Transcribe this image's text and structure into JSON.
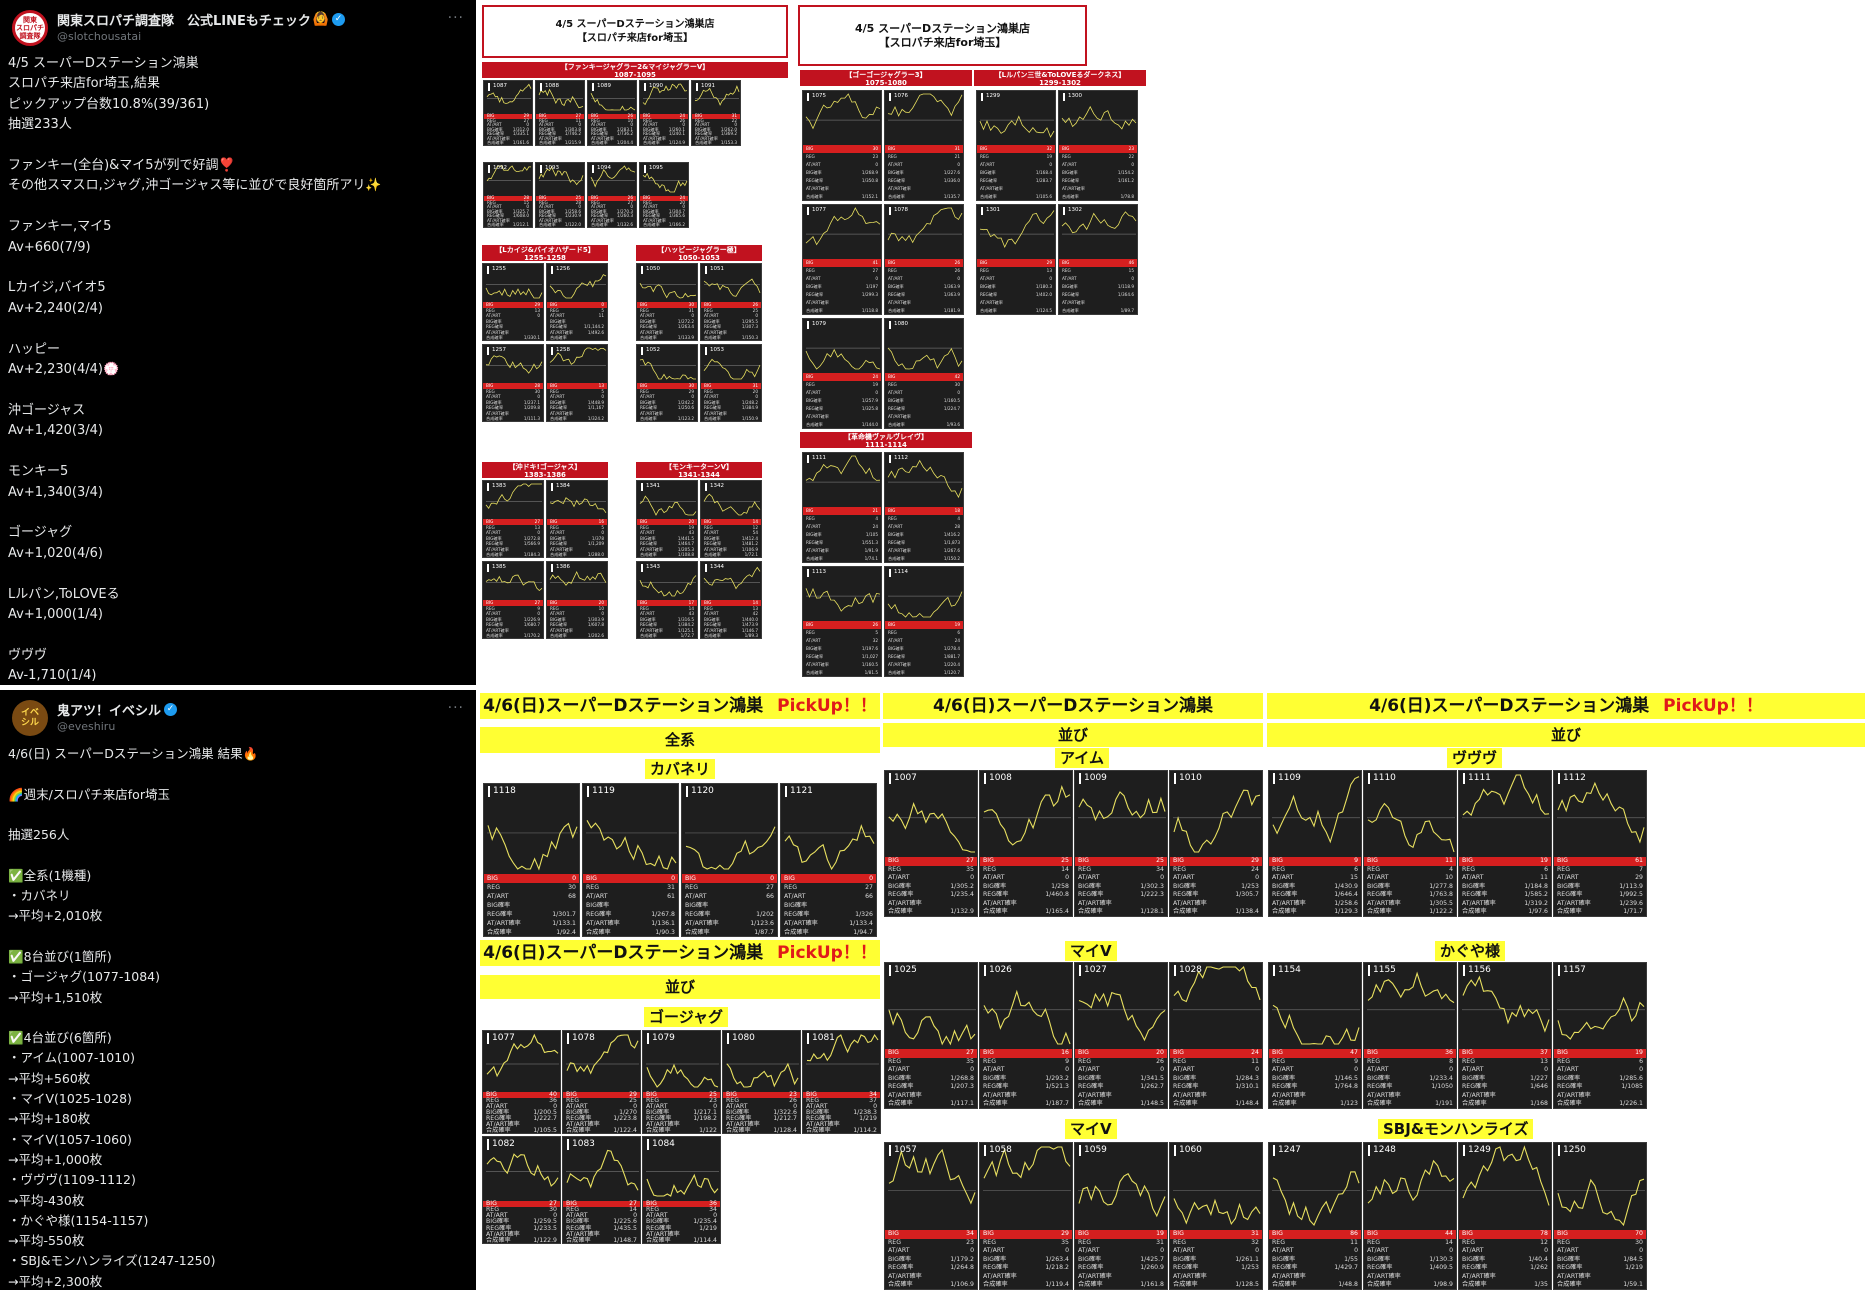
{
  "post1": {
    "display_name": "関東スロパチ調査隊　公式LINEもチェック",
    "emoji_badge": "🙆",
    "handle": "@slotchousatai",
    "avatar_text": "関東\nスロパチ\n調査隊",
    "more": "···",
    "body": "4/5 スーパーDステーション鴻巣\nスロパチ来店for埼玉,結果\nピックアップ台数10.8%(39/361)\n抽選233人\n\nファンキー(全台)&マイ5が列で好調❣️\nその他スマスロ,ジャグ,沖ゴージャス等に並びで良好箇所アリ✨\n\nファンキー,マイ5\nAv+660(7/9)\n\nLカイジ,バイオ5\nAv+2,240(2/4)\n\nハッピー\nAv+2,230(4/4)💮\n\n沖ゴージャス\nAv+1,420(3/4)\n\nモンキー5\nAv+1,340(3/4)\n\nゴージャグ\nAv+1,020(4/6)\n\nLルパン,ToLOVEる\nAv+1,000(1/4)\n\nヴヴヴ\nAv-1,710(1/4)"
  },
  "post2": {
    "display_name": "鬼アツ！イベシル",
    "handle": "@eveshiru",
    "avatar_text": "イベ\nシル",
    "more": "···",
    "body": "4/6(日) スーパーDステーション鴻巣 結果🔥\n\n🌈週末/スロパチ来店for埼玉\n\n抽選256人\n\n✅全系(1機種)\n・カバネリ\n→平均+2,010枚\n\n✅8台並び(1箇所)\n・ゴージャグ(1077-1084)\n→平均+1,510枚\n\n✅4台並び(6箇所)\n・アイム(1007-1010)\n→平均+560枚\n・マイV(1025-1028)\n→平均+180枚\n・マイV(1057-1060)\n→平均+1,000枚\n・ヴヴヴ(1109-1112)\n→平均-430枚\n・かぐや様(1154-1157)\n→平均-550枚\n・SBJ&モンハンライズ(1247-1250)\n→平均+2,300枚"
  },
  "img45": {
    "title_a": "4/5 スーパーDステーション鴻巣店",
    "title_b": "【スロパチ来店for埼玉】",
    "groups": [
      {
        "label": "【ファンキージャグラー2&マイジャグラーV】",
        "range": "1087-1095",
        "machines": [
          "1087",
          "1088",
          "1089",
          "1090",
          "1091",
          "1092",
          "1093",
          "1094",
          "1095"
        ]
      },
      {
        "label": "【Lカイジ&バイオハザード5】",
        "range": "1255-1258",
        "machines": [
          "1255",
          "1256",
          "1257",
          "1258"
        ]
      },
      {
        "label": "【ハッピージャグラー極】",
        "range": "1050-1053",
        "machines": [
          "1050",
          "1051",
          "1052",
          "1053"
        ]
      },
      {
        "label": "【沖ドキ!ゴージャス】",
        "range": "1383-1386",
        "machines": [
          "1383",
          "1384",
          "1385",
          "1386"
        ]
      },
      {
        "label": "【モンキーターンV】",
        "range": "1341-1344",
        "machines": [
          "1341",
          "1342",
          "1343",
          "1344"
        ]
      },
      {
        "label": "【ゴーゴージャグラー3】",
        "range": "1075-1080",
        "machines": [
          "1075",
          "1076",
          "1077",
          "1078",
          "1079",
          "1080"
        ]
      },
      {
        "label": "【Lルパン三世&ToLOVEるダークネス】",
        "range": "1299-1302",
        "machines": [
          "1299",
          "1300",
          "1301",
          "1302"
        ]
      },
      {
        "label": "【革命機ヴァルヴレイヴ】",
        "range": "1111-1114",
        "machines": [
          "1111",
          "1112",
          "1113",
          "1114"
        ]
      }
    ],
    "stat_labels": [
      "BIG",
      "REG",
      "AT/ART",
      "BIG確率",
      "REG確率",
      "AT/ART確率",
      "合成確率"
    ],
    "mini_values": [
      [
        "1087",
        "29",
        "27",
        "0",
        "1/312.0",
        "1/335.1",
        "",
        "1/161.6"
      ],
      [
        "1088",
        "27",
        "11",
        "0",
        "1/303.8",
        "1/746.2",
        "",
        "1/215.9"
      ],
      [
        "1089",
        "26",
        "10",
        "0",
        "1/283.1",
        "1/736.2",
        "",
        "1/204.4"
      ],
      [
        "1090",
        "24",
        "26",
        "0",
        "1/260.1",
        "1/240.1",
        "",
        "1/124.9"
      ],
      [
        "1091",
        "31",
        "22",
        "0",
        "1/262.0",
        "1/369.2",
        "",
        "1/153.3"
      ],
      [
        "1092",
        "28",
        "15",
        "0",
        "1/325.7",
        "1/608.0",
        "",
        "1/212.1"
      ],
      [
        "1093",
        "25",
        "28",
        "0",
        "1/258.6",
        "1/230.9",
        "",
        "1/122.0"
      ],
      [
        "1094",
        "26",
        "27",
        "0",
        "1/270.3",
        "1/260.3",
        "",
        "1/132.6"
      ],
      [
        "1095",
        "24",
        "20",
        "0",
        "1/304.7",
        "1/365.6",
        "",
        "1/166.2"
      ],
      [
        "1255",
        "29",
        "13",
        "0",
        "",
        "",
        "",
        "1/330.1"
      ],
      [
        "1256",
        "0",
        "5",
        "11",
        "",
        "1/1,144.2",
        "1/492.6",
        ""
      ],
      [
        "1050",
        "30",
        "31",
        "0",
        "1/272.2",
        "1/263.4",
        "",
        "1/133.9"
      ],
      [
        "1051",
        "26",
        "25",
        "0",
        "1/295.5",
        "1/307.3",
        "",
        "1/150.3"
      ],
      [
        "1257",
        "28",
        "30",
        "0",
        "1/237.1",
        "1/209.8",
        "",
        "1/111.3"
      ],
      [
        "1258",
        "13",
        "5",
        "0",
        "1/448.9",
        "1/1,167",
        "",
        "1/324.2"
      ],
      [
        "1052",
        "30",
        "29",
        "0",
        "1/242.2",
        "1/250.6",
        "",
        "1/123.2"
      ],
      [
        "1053",
        "31",
        "20",
        "0",
        "1/248.2",
        "1/384.9",
        "",
        "1/150.9"
      ],
      [
        "1383",
        "27",
        "13",
        "0",
        "1/272.8",
        "1/566.9",
        "",
        "1/184.3"
      ],
      [
        "1384",
        "16",
        "5",
        "0",
        "1/378",
        "1/1,209",
        "",
        "1/288.0"
      ],
      [
        "1341",
        "20",
        "19",
        "43",
        "1/441.5",
        "1/464.7",
        "1/205.3",
        "1/108.8"
      ],
      [
        "1342",
        "14",
        "12",
        "54",
        "1/412.4",
        "1/481.2",
        "1/106.9",
        "1/72.1"
      ],
      [
        "1385",
        "27",
        "9",
        "0",
        "1/226.9",
        "1/680.7",
        "",
        "1/170.2"
      ],
      [
        "1386",
        "20",
        "10",
        "0",
        "1/303.9",
        "1/607.8",
        "",
        "1/202.6"
      ],
      [
        "1343",
        "17",
        "14",
        "43",
        "1/316.5",
        "1/384.2",
        "1/125.1",
        "1/72.7"
      ],
      [
        "1344",
        "14",
        "13",
        "42",
        "1/440.0",
        "1/473.9",
        "1/146.7",
        "1/89.3"
      ]
    ],
    "right_values": [
      [
        "1075",
        "30",
        "23",
        "0",
        "1/268.9",
        "1/350.8",
        "",
        "1/152.1"
      ],
      [
        "1076",
        "31",
        "21",
        "0",
        "1/227.6",
        "1/336.0",
        "",
        "1/135.7"
      ],
      [
        "1077",
        "41",
        "27",
        "0",
        "1/197",
        "1/299.3",
        "",
        "1/118.8"
      ],
      [
        "1078",
        "26",
        "26",
        "0",
        "1/363.9",
        "1/363.9",
        "",
        "1/181.9"
      ],
      [
        "1079",
        "24",
        "19",
        "0",
        "1/257.9",
        "1/325.8",
        "",
        "1/144.0"
      ],
      [
        "1080",
        "42",
        "30",
        "0",
        "1/160.5",
        "1/224.7",
        "",
        "1/93.6"
      ],
      [
        "1299",
        "32",
        "19",
        "0",
        "1/168.4",
        "1/283.7",
        "",
        "1/105.6"
      ],
      [
        "1300",
        "23",
        "22",
        "0",
        "1/154.2",
        "1/161.2",
        "",
        "1/78.8"
      ],
      [
        "1301",
        "29",
        "13",
        "0",
        "1/180.3",
        "1/402.0",
        "",
        "1/124.5"
      ],
      [
        "1302",
        "46",
        "15",
        "0",
        "1/118.9",
        "1/364.6",
        "",
        "1/89.7"
      ],
      [
        "1111",
        "21",
        "4",
        "24",
        "1/105",
        "1/551.3",
        "1/91.9",
        "1/74.1"
      ],
      [
        "1112",
        "18",
        "4",
        "28",
        "1/416.2",
        "1/1,873",
        "1/267.6",
        "1/150.2"
      ],
      [
        "1113",
        "26",
        "5",
        "32",
        "1/197.6",
        "1/1,027",
        "1/160.5",
        "1/81.5"
      ],
      [
        "1114",
        "19",
        "6",
        "24",
        "1/278.4",
        "1/881.7",
        "1/220.4",
        "1/120.7"
      ]
    ]
  },
  "img46": {
    "header": "4/6(日)スーパーDステーション鴻巣",
    "pickup": "PickUp！！",
    "sec_all": "全系",
    "sec_narabi": "並び",
    "stat_labels": [
      "BIG",
      "REG",
      "AT/ART",
      "BIG確率",
      "REG確率",
      "AT/ART確率",
      "合成確率"
    ],
    "groups": [
      {
        "name": "カバネリ",
        "machines": [
          {
            "no": "1118",
            "v": [
              "0",
              "30",
              "68",
              "",
              "",
              "1/301.7",
              "1/133.1",
              "1/92.4"
            ]
          },
          {
            "no": "1119",
            "v": [
              "0",
              "31",
              "61",
              "",
              "",
              "1/267.8",
              "1/136.1",
              "1/90.3"
            ]
          },
          {
            "no": "1120",
            "v": [
              "0",
              "27",
              "66",
              "",
              "",
              "1/202",
              "1/123.6",
              "1/87.7"
            ]
          },
          {
            "no": "1121",
            "v": [
              "0",
              "27",
              "66",
              "",
              "",
              "1/326",
              "1/133.4",
              "1/94.7"
            ]
          }
        ]
      },
      {
        "name": "ゴージャグ",
        "machines": [
          {
            "no": "1077",
            "v": [
              "40",
              "36",
              "0",
              "1/200.5",
              "1/222.7",
              "",
              "1/105.5"
            ]
          },
          {
            "no": "1078",
            "v": [
              "29",
              "25",
              "0",
              "1/270",
              "1/223.8",
              "",
              "1/122.4"
            ]
          },
          {
            "no": "1079",
            "v": [
              "25",
              "23",
              "0",
              "1/217.1",
              "1/198.2",
              "",
              "1/122"
            ]
          },
          {
            "no": "1080",
            "v": [
              "23",
              "26",
              "0",
              "1/322.6",
              "1/212.7",
              "",
              "1/128.4"
            ]
          },
          {
            "no": "1081",
            "v": [
              "34",
              "37",
              "0",
              "1/238.3",
              "1/219",
              "",
              "1/114.2"
            ]
          },
          {
            "no": "1082",
            "v": [
              "27",
              "30",
              "0",
              "1/259.5",
              "1/233.5",
              "",
              "1/122.9"
            ]
          },
          {
            "no": "1083",
            "v": [
              "27",
              "14",
              "0",
              "1/225.6",
              "1/435.5",
              "",
              "1/148.7"
            ]
          },
          {
            "no": "1084",
            "v": [
              "36",
              "34",
              "0",
              "1/235.4",
              "1/219",
              "",
              "1/114.4"
            ]
          }
        ]
      },
      {
        "name": "アイム",
        "machines": [
          {
            "no": "1007",
            "v": [
              "27",
              "35",
              "0",
              "1/305.2",
              "1/235.4",
              "",
              "1/132.9"
            ]
          },
          {
            "no": "1008",
            "v": [
              "25",
              "14",
              "0",
              "1/258",
              "1/460.8",
              "",
              "1/165.4"
            ]
          },
          {
            "no": "1009",
            "v": [
              "25",
              "34",
              "0",
              "1/302.3",
              "1/222.3",
              "",
              "1/128.1"
            ]
          },
          {
            "no": "1010",
            "v": [
              "29",
              "24",
              "0",
              "1/253",
              "1/305.7",
              "",
              "1/138.4"
            ]
          }
        ]
      },
      {
        "name": "マイV",
        "machines": [
          {
            "no": "1025",
            "v": [
              "27",
              "35",
              "0",
              "1/268.8",
              "1/207.3",
              "",
              "1/117.1"
            ]
          },
          {
            "no": "1026",
            "v": [
              "16",
              "9",
              "0",
              "1/293.2",
              "1/521.3",
              "",
              "1/187.7"
            ]
          },
          {
            "no": "1027",
            "v": [
              "20",
              "26",
              "0",
              "1/341.5",
              "1/262.7",
              "",
              "1/148.5"
            ]
          },
          {
            "no": "1028",
            "v": [
              "24",
              "11",
              "0",
              "1/284.3",
              "1/310.1",
              "",
              "1/148.4"
            ]
          }
        ]
      },
      {
        "name": "マイV",
        "machines": [
          {
            "no": "1057",
            "v": [
              "34",
              "23",
              "0",
              "1/179.2",
              "1/264.8",
              "",
              "1/106.9"
            ]
          },
          {
            "no": "1058",
            "v": [
              "29",
              "35",
              "0",
              "1/263.4",
              "1/218.2",
              "",
              "1/119.4"
            ]
          },
          {
            "no": "1059",
            "v": [
              "19",
              "31",
              "0",
              "1/425.7",
              "1/260.9",
              "",
              "1/161.8"
            ]
          },
          {
            "no": "1060",
            "v": [
              "31",
              "32",
              "0",
              "1/261.1",
              "1/253",
              "",
              "1/128.5"
            ]
          }
        ]
      },
      {
        "name": "ヴヴヴ",
        "machines": [
          {
            "no": "1109",
            "v": [
              "9",
              "6",
              "15",
              "1/430.9",
              "1/646.4",
              "1/258.6",
              "1/129.3"
            ]
          },
          {
            "no": "1110",
            "v": [
              "11",
              "4",
              "10",
              "1/277.8",
              "1/763.8",
              "1/305.5",
              "1/122.2"
            ]
          },
          {
            "no": "1111",
            "v": [
              "19",
              "6",
              "11",
              "1/184.8",
              "1/585.2",
              "1/319.2",
              "1/97.6"
            ]
          },
          {
            "no": "1112",
            "v": [
              "61",
              "7",
              "29",
              "1/113.9",
              "1/992.5",
              "1/239.6",
              "1/71.7"
            ]
          }
        ]
      },
      {
        "name": "かぐや様",
        "machines": [
          {
            "no": "1154",
            "v": [
              "47",
              "9",
              "0",
              "1/146.5",
              "1/764.8",
              "",
              "1/123"
            ]
          },
          {
            "no": "1155",
            "v": [
              "36",
              "8",
              "0",
              "1/233.4",
              "1/1050",
              "",
              "1/191"
            ]
          },
          {
            "no": "1156",
            "v": [
              "37",
              "13",
              "0",
              "1/227",
              "1/646",
              "",
              "1/168"
            ]
          },
          {
            "no": "1157",
            "v": [
              "19",
              "6",
              "0",
              "1/285.6",
              "1/1085",
              "",
              "1/226.1"
            ]
          }
        ]
      },
      {
        "name": "SBJ&モンハンライズ",
        "machines": [
          {
            "no": "1247",
            "v": [
              "86",
              "11",
              "0",
              "1/55",
              "1/429.7",
              "",
              "1/48.8"
            ]
          },
          {
            "no": "1248",
            "v": [
              "44",
              "14",
              "0",
              "1/130.3",
              "1/409.5",
              "",
              "1/98.9"
            ]
          },
          {
            "no": "1249",
            "v": [
              "78",
              "12",
              "0",
              "1/40.4",
              "1/262",
              "",
              "1/35"
            ]
          },
          {
            "no": "1250",
            "v": [
              "70",
              "30",
              "0",
              "1/84.5",
              "1/219",
              "",
              "1/59.1"
            ]
          }
        ]
      }
    ]
  },
  "colors": {
    "accent_red": "#c1121f",
    "highlight_yellow": "#ffff33",
    "chart_line": "#e8e060",
    "card_bg": "#1e1e1e"
  }
}
